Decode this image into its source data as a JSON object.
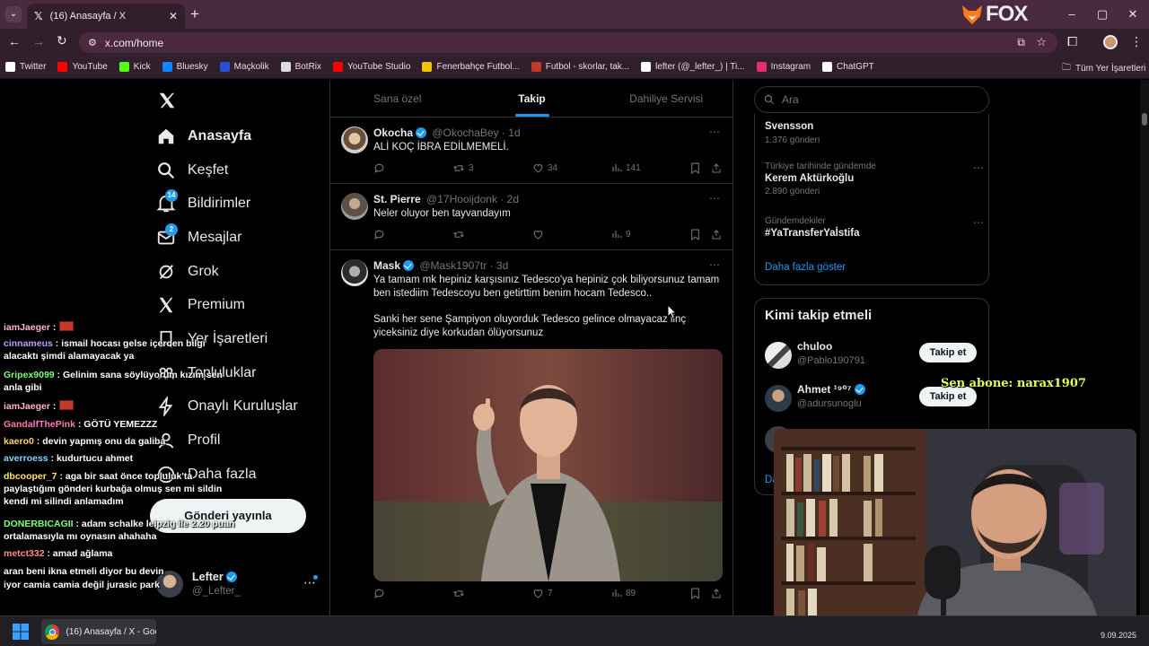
{
  "browser": {
    "tab_title": "(16) Anasayfa / X",
    "url": "x.com/home",
    "fox_logo": "FOX",
    "bookmarks": [
      {
        "label": "Twitter",
        "color": "#ffffff",
        "icon": "x-logo-icon"
      },
      {
        "label": "YouTube",
        "color": "#ff0000",
        "icon": "youtube-icon"
      },
      {
        "label": "Kick",
        "color": "#53fc18",
        "icon": "kick-icon"
      },
      {
        "label": "Bluesky",
        "color": "#1185fe",
        "icon": "butterfly-icon"
      },
      {
        "label": "Maçkolik",
        "color": "#2b4fd1",
        "icon": "mackolik-icon"
      },
      {
        "label": "BotRix",
        "color": "#dddddd",
        "icon": "botrix-icon"
      },
      {
        "label": "YouTube Studio",
        "color": "#ff0000",
        "icon": "youtube-studio-icon"
      },
      {
        "label": "Fenerbahçe Futbol...",
        "color": "#f5c400",
        "icon": "fenerbahce-icon"
      },
      {
        "label": "Futbol - skorlar, tak...",
        "color": "#c0392b",
        "icon": "flashscore-icon"
      },
      {
        "label": "lefter (@_lefter_) | Ti...",
        "color": "#ffffff",
        "icon": "tiktok-icon"
      },
      {
        "label": "Instagram",
        "color": "#e1306c",
        "icon": "instagram-icon"
      },
      {
        "label": "ChatGPT",
        "color": "#ffffff",
        "icon": "chatgpt-icon"
      }
    ],
    "all_bookmarks": "Tüm Yer İşaretleri"
  },
  "sidebar": {
    "items": [
      {
        "label": "Anasayfa",
        "active": true
      },
      {
        "label": "Keşfet"
      },
      {
        "label": "Bildirimler",
        "badge": "14"
      },
      {
        "label": "Mesajlar",
        "badge": "2"
      },
      {
        "label": "Grok"
      },
      {
        "label": "Premium"
      },
      {
        "label": "Yer İşaretleri"
      },
      {
        "label": "Topluluklar"
      },
      {
        "label": "Onaylı Kuruluşlar"
      },
      {
        "label": "Profil"
      },
      {
        "label": "Daha fazla"
      }
    ],
    "post_button": "Gönderi yayınla",
    "account_name": "Lefter",
    "account_handle": "@_Lefter_"
  },
  "feed": {
    "tabs": [
      "Sana özel",
      "Takip",
      "Dahiliye Servisi"
    ],
    "active_tab": "Takip",
    "tweets": [
      {
        "name": "Okocha",
        "verified": true,
        "handle": "@OkochaBey",
        "time": "1d",
        "text": "ALİ KOÇ İBRA EDİLMEMELİ.",
        "retweets": "3",
        "likes": "34",
        "views": "141"
      },
      {
        "name": "St. Pierre",
        "verified": false,
        "handle": "@17Hooijdonk",
        "time": "2d",
        "text": "Neler oluyor ben tayvandayım",
        "retweets": "",
        "likes": "",
        "views": "9"
      },
      {
        "name": "Mask",
        "verified": true,
        "handle": "@Mask1907tr",
        "time": "3d",
        "text1": "Ya tamam mk hepiniz karşısınız Tedesco'ya hepiniz çok biliyorsunuz tamam ben istediim Tedescoyu ben getirttim benim hocam Tedesco..",
        "text2": "Sanki her sene Şampiyon oluyorduk Tedesco gelince olmayacaz linç yiceksiniz diye korkudan ölüyorsunuz",
        "retweets": "",
        "likes": "7",
        "views": "89"
      }
    ]
  },
  "right": {
    "search_placeholder": "Ara",
    "trends": [
      {
        "meta": "",
        "title": "Svensson",
        "count": "1.376 gönderi"
      },
      {
        "meta": "Türkiye tarihinde gündemde",
        "title": "Kerem Aktürkoğlu",
        "count": "2.890 gönderi"
      },
      {
        "meta": "Gündemdekiler",
        "title": "#YaTransferYaİstifa",
        "count": ""
      }
    ],
    "show_more": "Daha fazla göster",
    "who_to_follow_title": "Kimi takip etmeli",
    "suggestions": [
      {
        "name": "chuloo",
        "handle": "@Pablo190791",
        "button": "Takip et"
      },
      {
        "name": "Ahmet ¹⁹⁰⁷",
        "handle": "@adursunoglu",
        "button": "Takip et",
        "verified": true
      }
    ],
    "partial_show_more": "Da"
  },
  "overlay": {
    "subscriber_alert": "Sen abone: narax1907",
    "chat": [
      {
        "user": "iamJaeger",
        "color": "#ffb3d9",
        "msg": ":"
      },
      {
        "user": "cinnameus",
        "color": "#c39bff",
        "msg": ": ismail hocası gelse içerden bilgi alacaktı şimdi alamayacak ya"
      },
      {
        "user": "Gripex9099",
        "color": "#7bff7b",
        "msg": ": Gelinim sana söylüyorum kızım sen anla gibi"
      },
      {
        "user": "iamJaeger",
        "color": "#ffb3d9",
        "msg": ":"
      },
      {
        "user": "GandalfThePink",
        "color": "#ff7ab8",
        "msg": ": GÖTÜ YEMEZZZ"
      },
      {
        "user": "kaero0",
        "color": "#ffd36b",
        "msg": ": devin yapmış onu da galiba"
      },
      {
        "user": "averroess",
        "color": "#7fd6ff",
        "msg": ": kudurtucu ahmet"
      },
      {
        "user": "dbcooper_7",
        "color": "#ffe066",
        "msg": ": aga bir saat önce topluluk'ta paylaştığım gönderi kurbağa olmuş sen mi sildin kendi mi silindi anlamadım"
      },
      {
        "user": "DONERBICAGII",
        "color": "#7bff7b",
        "msg": ": adam schalke leipzig ile 2.20 puan ortalamasıyla mı oynasın ahahaha"
      },
      {
        "user": "metct332",
        "color": "#ff8c8c",
        "msg": ": amad ağlama"
      },
      {
        "user": "",
        "color": "#ffffff",
        "msg": "aran beni ikna etmeli diyor bu devin"
      },
      {
        "user": "",
        "color": "#ffffff",
        "msg": "iyor camia camia değil jurasic park"
      }
    ]
  },
  "taskbar": {
    "app_title": "(16) Anasayfa / X - Goog",
    "date": "9.09.2025"
  },
  "colors": {
    "accent": "#1d9bf0",
    "chrome": "#4a2a41",
    "toolbar": "#311f2c"
  }
}
